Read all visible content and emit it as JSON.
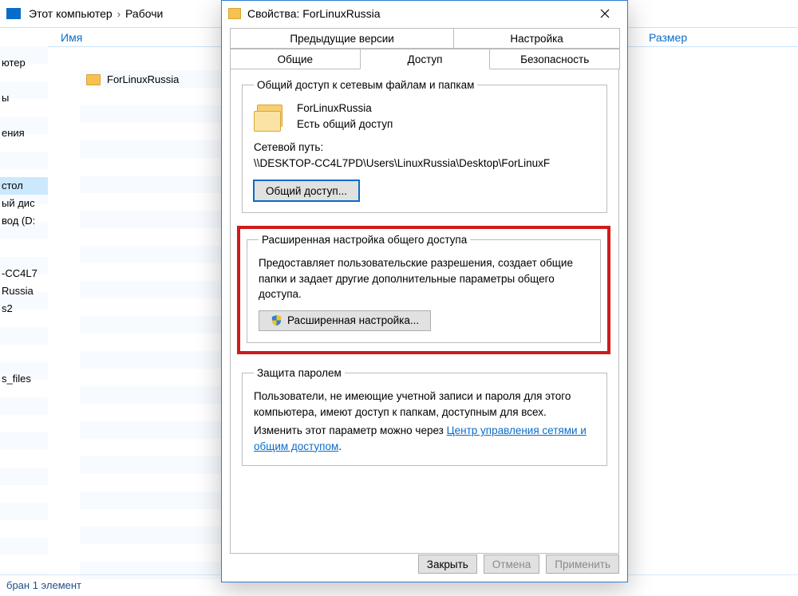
{
  "breadcrumb": {
    "segment1": "Этот компьютер",
    "segment2": "Рабочи"
  },
  "columns": {
    "name": "Имя",
    "size": "Размер"
  },
  "sidebar": {
    "items": [
      "ютер",
      "",
      "ы",
      "",
      "ения",
      "",
      "",
      "стол",
      "ый дис",
      "вод (D:",
      "",
      "",
      "-CC4L7",
      "Russia",
      "s2",
      "",
      "",
      "",
      "s_files"
    ]
  },
  "sidebar_selected_index": 7,
  "listing": {
    "item1": "ForLinuxRussia"
  },
  "statusbar": "бран 1 элемент",
  "dialog": {
    "title": "Свойства: ForLinuxRussia",
    "tabs_row1": [
      "Предыдущие версии",
      "Настройка"
    ],
    "tabs_row2": [
      "Общие",
      "Доступ",
      "Безопасность"
    ],
    "active_tab_index": 1,
    "group1": {
      "legend": "Общий доступ к сетевым файлам и папкам",
      "name": "ForLinuxRussia",
      "status": "Есть общий доступ",
      "netpath_label": "Сетевой путь:",
      "netpath": "\\\\DESKTOP-CC4L7PD\\Users\\LinuxRussia\\Desktop\\ForLinuxF",
      "share_btn": "Общий доступ..."
    },
    "group2": {
      "legend": "Расширенная настройка общего доступа",
      "desc": "Предоставляет пользовательские разрешения, создает общие папки и задает другие дополнительные параметры общего доступа.",
      "btn": "Расширенная настройка..."
    },
    "group3": {
      "legend": "Защита паролем",
      "desc": "Пользователи, не имеющие учетной записи и пароля для этого компьютера, имеют доступ к папкам, доступным для всех.",
      "change_prefix": "Изменить этот параметр можно через ",
      "link": "Центр управления сетями и общим доступом",
      "suffix": "."
    },
    "buttons": {
      "close": "Закрыть",
      "cancel": "Отмена",
      "apply": "Применить"
    }
  }
}
